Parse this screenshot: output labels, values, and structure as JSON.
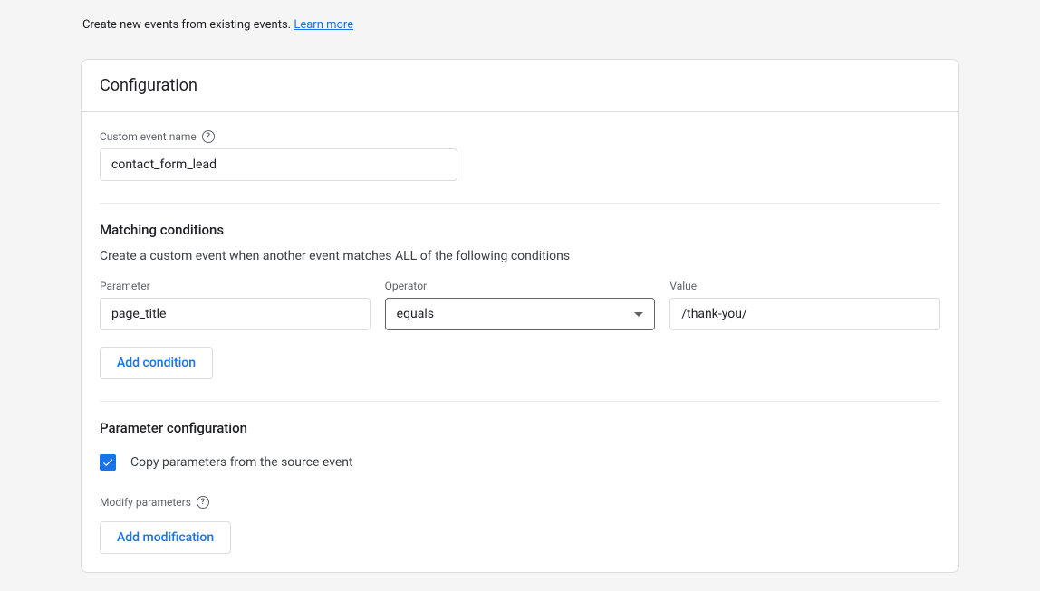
{
  "intro": {
    "text": "Create new events from existing events. ",
    "link": "Learn more"
  },
  "card_title": "Configuration",
  "event_name": {
    "label": "Custom event name",
    "value": "contact_form_lead"
  },
  "matching": {
    "title": "Matching conditions",
    "desc": "Create a custom event when another event matches ALL of the following conditions",
    "labels": {
      "parameter": "Parameter",
      "operator": "Operator",
      "value": "Value"
    },
    "row": {
      "parameter": "page_title",
      "operator": "equals",
      "value": "/thank-you/"
    },
    "add_button": "Add condition"
  },
  "param_config": {
    "title": "Parameter configuration",
    "checkbox_label": "Copy parameters from the source event",
    "checked": true,
    "modify_label": "Modify parameters",
    "add_button": "Add modification"
  }
}
